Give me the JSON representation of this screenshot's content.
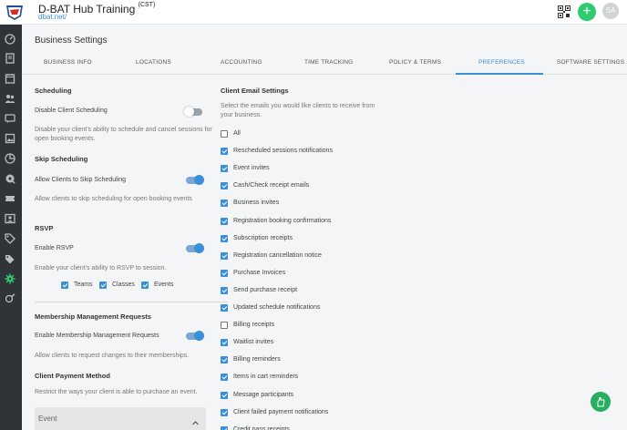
{
  "header": {
    "app_name": "D-BAT Hub Training",
    "timezone": "(CST)",
    "url": "dbat.net/",
    "add_label": "+",
    "avatar_initials": "SA"
  },
  "sidebar": {
    "icons": [
      "dashboard-icon",
      "book-icon",
      "calendar-icon",
      "people-icon",
      "chat-icon",
      "image-icon",
      "reports-icon",
      "settings-alt-icon",
      "ticket-icon",
      "id-card-icon",
      "tag-icon",
      "tags-icon",
      "gear-icon",
      "wrench-icon"
    ],
    "active_icon": "gear-icon",
    "active_color": "#2ecc71"
  },
  "page": {
    "title": "Business Settings",
    "tabs": [
      "BUSINESS INFO",
      "LOCATIONS",
      "ACCOUNTING",
      "TIME TRACKING",
      "POLICY & TERMS",
      "PREFERENCES",
      "SOFTWARE SETTINGS"
    ],
    "active_tab": "PREFERENCES"
  },
  "left": {
    "scheduling": {
      "title": "Scheduling",
      "toggle_label": "Disable Client Scheduling",
      "toggle_on": false,
      "description": "Disable your client's ability to schedule and cancel sessions for open booking events."
    },
    "skip_scheduling": {
      "title": "Skip Scheduling",
      "toggle_label": "Allow Clients to Skip Scheduling",
      "toggle_on": true,
      "description": "Allow clients to skip scheduling for open booking events"
    },
    "rsvp": {
      "title": "RSVP",
      "toggle_label": "Enable RSVP",
      "toggle_on": true,
      "description": "Enable your client's ability to RSVP to session.",
      "options": [
        {
          "label": "Teams",
          "checked": true
        },
        {
          "label": "Classes",
          "checked": true
        },
        {
          "label": "Events",
          "checked": true
        }
      ]
    },
    "membership": {
      "title": "Membership Management Requests",
      "toggle_label": "Enable Membership Management Requests",
      "toggle_on": true,
      "description": "Allow clients to request changes to their memberships."
    },
    "payment": {
      "title": "Client Payment Method",
      "description": "Restrict the ways your client is able to purchase an event.",
      "select_value": "Event"
    }
  },
  "right": {
    "title": "Client Email Settings",
    "description": "Select the emails you would like clients to receive from your business.",
    "emails": [
      {
        "label": "All",
        "checked": false
      },
      {
        "label": "Rescheduled sessions notifications",
        "checked": true
      },
      {
        "label": "Event invites",
        "checked": true
      },
      {
        "label": "Cash/Check receipt emails",
        "checked": true
      },
      {
        "label": "Business invites",
        "checked": true
      },
      {
        "label": "Registration booking confirmations",
        "checked": true
      },
      {
        "label": "Subscription receipts",
        "checked": true
      },
      {
        "label": "Registration cancellation notice",
        "checked": true
      },
      {
        "label": "Purchase Invoices",
        "checked": true
      },
      {
        "label": "Send purchase receipt",
        "checked": true
      },
      {
        "label": "Updated schedule notifications",
        "checked": true
      },
      {
        "label": "Billing receipts",
        "checked": false
      },
      {
        "label": "Waitlist invites",
        "checked": true
      },
      {
        "label": "Billing reminders",
        "checked": true
      },
      {
        "label": "Items in cart reminders",
        "checked": true
      },
      {
        "label": "Message participants",
        "checked": true
      },
      {
        "label": "Client failed payment notifications",
        "checked": true
      },
      {
        "label": "Credit pass receipts",
        "checked": true
      }
    ]
  },
  "colors": {
    "accent": "#3b8fd6",
    "sidebar_bg": "#2f3438",
    "add_button": "#2ecc71"
  }
}
